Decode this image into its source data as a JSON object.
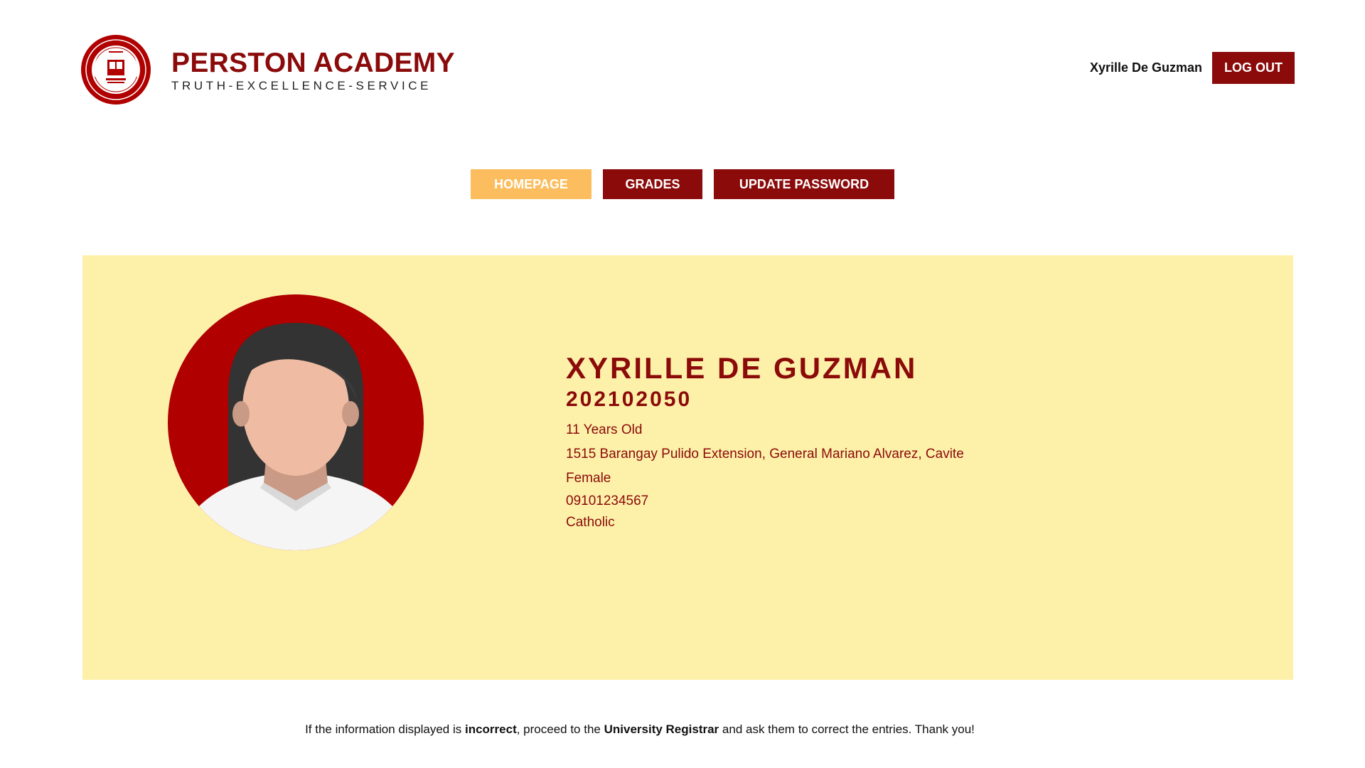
{
  "header": {
    "school_name": "PERSTON ACADEMY",
    "motto": "TRUTH-EXCELLENCE-SERVICE",
    "logo_icon": "school-seal-icon",
    "user_name": "Xyrille De Guzman",
    "logout_label": "LOG OUT"
  },
  "nav": {
    "items": [
      {
        "label": "HOMEPAGE",
        "active": true
      },
      {
        "label": "GRADES",
        "active": false
      },
      {
        "label": "UPDATE PASSWORD",
        "active": false
      }
    ]
  },
  "profile": {
    "avatar_icon": "female-avatar-icon",
    "name": "XYRILLE DE GUZMAN",
    "student_id": "202102050",
    "age": "11 Years Old",
    "address": "1515 Barangay Pulido Extension, General Mariano Alvarez, Cavite",
    "gender": "Female",
    "phone": "09101234567",
    "religion": "Catholic"
  },
  "note": {
    "part1": "If the information displayed is ",
    "bold1": "incorrect",
    "part2": ", proceed to the ",
    "bold2": "University Registrar",
    "part3": " and ask them to correct the entries. Thank you!"
  },
  "colors": {
    "brand_red": "#8b0a0a",
    "active_tab": "#fbbd5e",
    "card_bg": "#fdf1a9"
  }
}
